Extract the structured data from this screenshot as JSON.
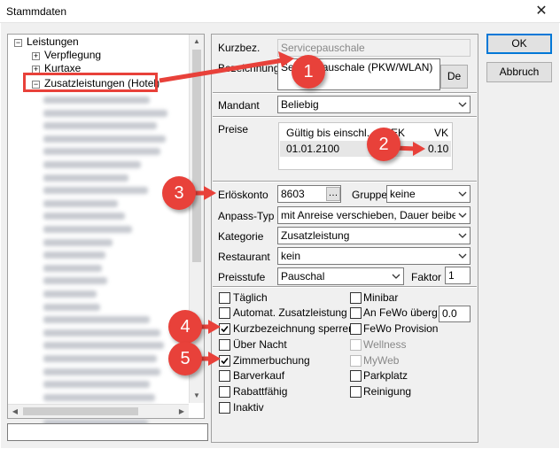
{
  "window": {
    "title": "Stammdaten",
    "close_glyph": "✕"
  },
  "tree": {
    "items": [
      {
        "label": "Leistungen",
        "expander": "−"
      },
      {
        "label": "Verpflegung",
        "expander": "+"
      },
      {
        "label": "Kurtaxe",
        "expander": "+"
      },
      {
        "label": "Zusatzleistungen (Hotel)",
        "expander": "−"
      }
    ],
    "blurred_count": 26
  },
  "form": {
    "kurzbez_label": "Kurzbez.",
    "kurzbez_value": "Servicepauschale",
    "bezeichnung_label": "Bezeichnung",
    "bezeichnung_value": "Servicepauschale (PKW/WLAN)",
    "de_button": "De",
    "mandant_label": "Mandant",
    "mandant_value": "Beliebig",
    "preise_label": "Preise",
    "preise_headers": {
      "gueltig": "Gültig bis einschl.",
      "ek": "EK",
      "vk": "VK"
    },
    "preise_rows": [
      {
        "gueltig": "01.01.2100",
        "ek": "",
        "vk": "0.10"
      }
    ],
    "erloeskonto_label": "Erlöskonto",
    "erloeskonto_value": "8603",
    "ellipsis": "…",
    "gruppe_label": "Gruppe",
    "gruppe_value": "keine",
    "anpass_label": "Anpass-Typ",
    "anpass_value": "mit Anreise verschieben, Dauer beibehalt",
    "kategorie_label": "Kategorie",
    "kategorie_value": "Zusatzleistung",
    "restaurant_label": "Restaurant",
    "restaurant_value": "kein",
    "preisstufe_label": "Preisstufe",
    "preisstufe_value": "Pauschal",
    "faktor_label": "Faktor",
    "faktor_value": "1"
  },
  "checkboxes_left": [
    {
      "label": "Täglich",
      "checked": false
    },
    {
      "label": "Automat. Zusatzleistung",
      "checked": false
    },
    {
      "label": "Kurzbezeichnung sperren",
      "checked": true
    },
    {
      "label": "Über Nacht",
      "checked": false
    },
    {
      "label": "Zimmerbuchung",
      "checked": true
    },
    {
      "label": "Barverkauf",
      "checked": false
    },
    {
      "label": "Rabattfähig",
      "checked": false
    },
    {
      "label": "Inaktiv",
      "checked": false
    }
  ],
  "checkboxes_right": [
    {
      "label": "Minibar",
      "checked": false,
      "disabled": false
    },
    {
      "label": "An FeWo überg.",
      "checked": false,
      "disabled": false
    },
    {
      "label": "FeWo Provision",
      "checked": false,
      "disabled": false
    },
    {
      "label": "Wellness",
      "checked": false,
      "disabled": true
    },
    {
      "label": "MyWeb",
      "checked": false,
      "disabled": true
    },
    {
      "label": "Parkplatz",
      "checked": false,
      "disabled": false
    },
    {
      "label": "Reinigung",
      "checked": false,
      "disabled": false
    }
  ],
  "fewo_value": "0.0",
  "buttons": {
    "ok": "OK",
    "cancel": "Abbruch"
  },
  "badges": [
    "1",
    "2",
    "3",
    "4",
    "5"
  ],
  "colors": {
    "annotation_red": "#e8413a",
    "focus_blue": "#0078d7"
  }
}
